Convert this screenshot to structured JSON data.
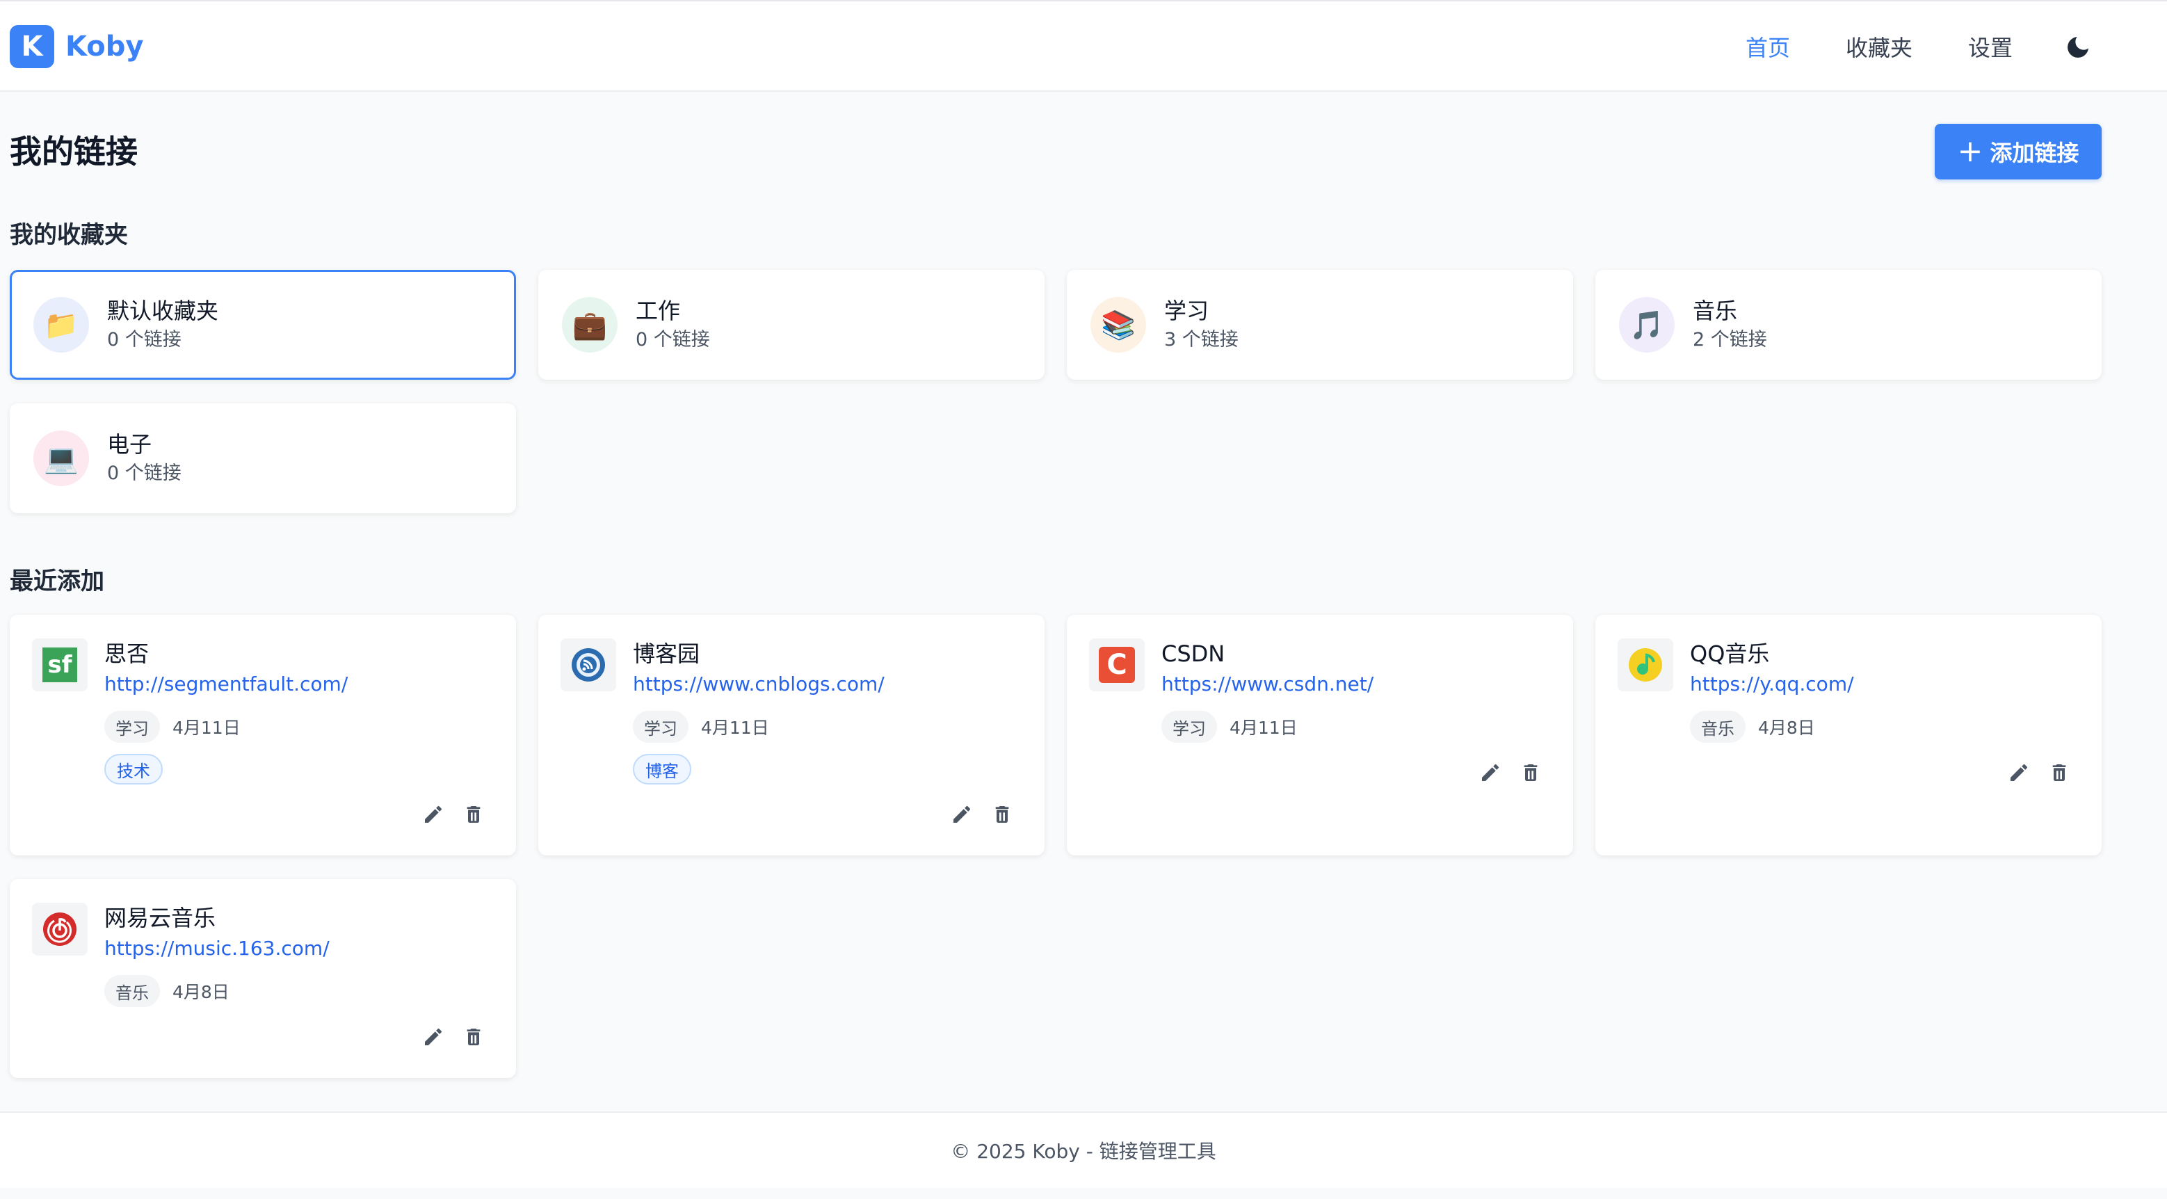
{
  "app": {
    "logo_letter": "K",
    "name": "Koby"
  },
  "nav": {
    "home": "首页",
    "favorites": "收藏夹",
    "settings": "设置"
  },
  "page": {
    "title": "我的链接",
    "add_button": "添加链接",
    "add_symbol": "+"
  },
  "folders_section": {
    "title": "我的收藏夹"
  },
  "folders": [
    {
      "name": "默认收藏夹",
      "count": "0 个链接",
      "icon": "📁",
      "icon_name": "folder-icon",
      "icon_bg": "#e8eefc"
    },
    {
      "name": "工作",
      "count": "0 个链接",
      "icon": "💼",
      "icon_name": "briefcase-icon",
      "icon_bg": "#e6f6ee"
    },
    {
      "name": "学习",
      "count": "3 个链接",
      "icon": "📚",
      "icon_name": "books-icon",
      "icon_bg": "#fdf1e3"
    },
    {
      "name": "音乐",
      "count": "2 个链接",
      "icon": "🎵",
      "icon_name": "music-note-icon",
      "icon_bg": "#f1ecfc"
    },
    {
      "name": "电子",
      "count": "0 个链接",
      "icon": "💻",
      "icon_name": "laptop-icon",
      "icon_bg": "#fce8ee"
    }
  ],
  "recent_section": {
    "title": "最近添加"
  },
  "links": [
    {
      "name": "思否",
      "url": "http://segmentfault.com/",
      "category": "学习",
      "date": "4月11日",
      "tag": "技术",
      "favicon": "segmentfault-favicon-icon"
    },
    {
      "name": "博客园",
      "url": "https://www.cnblogs.com/",
      "category": "学习",
      "date": "4月11日",
      "tag": "博客",
      "favicon": "cnblogs-favicon-icon"
    },
    {
      "name": "CSDN",
      "url": "https://www.csdn.net/",
      "category": "学习",
      "date": "4月11日",
      "favicon": "csdn-favicon-icon"
    },
    {
      "name": "QQ音乐",
      "url": "https://y.qq.com/",
      "category": "音乐",
      "date": "4月8日",
      "favicon": "qq-music-favicon-icon"
    },
    {
      "name": "网易云音乐",
      "url": "https://music.163.com/",
      "category": "音乐",
      "date": "4月8日",
      "favicon": "netease-music-favicon-icon"
    }
  ],
  "favicon_text": {
    "segmentfault": "sf",
    "csdn": "C"
  },
  "colors": {
    "accent": "#3b82f6",
    "link": "#2563eb",
    "csdn": "#e94f35",
    "segmentfault": "#3aa357",
    "netease": "#d42b2b",
    "qqmusic": "#f5d023"
  },
  "footer": {
    "text": "© 2025 Koby - 链接管理工具"
  }
}
